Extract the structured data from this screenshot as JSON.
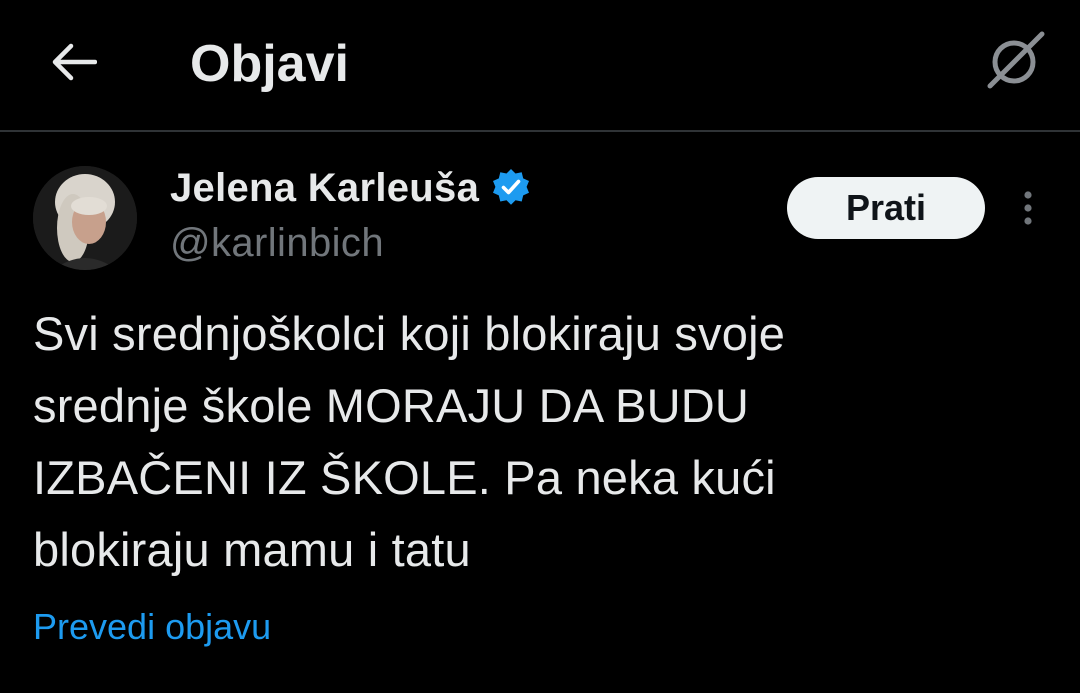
{
  "header": {
    "title": "Objavi",
    "back_icon": "arrow-left-icon",
    "grok_icon": "grok-icon"
  },
  "author": {
    "name": "Jelena Karleuša",
    "handle": "@karlinbich",
    "verified": true,
    "verified_color": "#1d9bf0"
  },
  "actions": {
    "follow_label": "Prati",
    "more_icon": "more-vertical-icon"
  },
  "post": {
    "lines": [
      "Svi srednjoškolci koji blokiraju svoje",
      "srednje škole MORAJU DA BUDU",
      "IZBAČENI IZ ŠKOLE. Pa neka kući",
      "blokiraju mamu i tatu"
    ],
    "translate_label": "Prevedi objavu"
  },
  "colors": {
    "background": "#000000",
    "text": "#e7e9ea",
    "secondary": "#71767b",
    "link": "#1d9bf0",
    "follow_bg": "#eff3f4"
  }
}
